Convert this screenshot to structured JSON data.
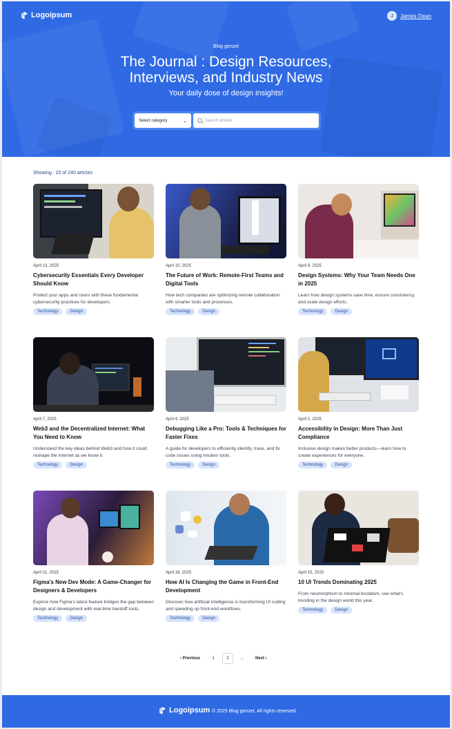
{
  "brand": {
    "name": "Logoipsum",
    "color": "#2f6ae4",
    "logo_icon": "logo-mark-icon"
  },
  "user": {
    "initial": "J",
    "name": "James Dean"
  },
  "hero": {
    "eyebrow": "Blog genzet",
    "title_line1": "The Journal : Design Resources,",
    "title_line2": "Interviews, and Industry News",
    "subtitle": "Your daily dose of design insights!"
  },
  "filters": {
    "category_selected": "Select category",
    "search_placeholder": "Search articles"
  },
  "showing": "Showing : 20 of 240 articles",
  "articles": [
    {
      "date": "April 13, 2025",
      "title": "Cybersecurity Essentials Every Developer Should Know",
      "description": "Protect your apps and users with these fundamental cybersecurity practices for developers.",
      "tags": [
        "Technology",
        "Design"
      ]
    },
    {
      "date": "April 10, 2025",
      "title": "The Future of Work: Remote-First Teams and Digital Tools",
      "description": "How tech companies are optimizing remote collaboration with smarter tools and processes.",
      "tags": [
        "Technology",
        "Design"
      ]
    },
    {
      "date": "April 9, 2025",
      "title": "Design Systems: Why Your Team Needs One in 2025",
      "description": "Learn how design systems save time, ensure consistency, and scale design efforts.",
      "tags": [
        "Technology",
        "Design"
      ]
    },
    {
      "date": "April 7, 2025",
      "title": "Web3 and the Decentralized Internet: What You Need to Know",
      "description": "Understand the key ideas behind Web3 and how it could reshape the internet as we know it.",
      "tags": [
        "Technology",
        "Design"
      ]
    },
    {
      "date": "April 4, 2025",
      "title": "Debugging Like a Pro: Tools & Techniques for Faster Fixes",
      "description": "A guide for developers to efficiently identify, trace, and fix code issues using modern tools.",
      "tags": [
        "Technology",
        "Design"
      ]
    },
    {
      "date": "April 2, 2025",
      "title": "Accessibility in Design: More Than Just Compliance",
      "description": "Inclusive design makes better products—learn how to create experiences for everyone.",
      "tags": [
        "Technology",
        "Design"
      ]
    },
    {
      "date": "April 21, 2025",
      "title": "Figma's New Dev Mode: A Game-Changer for Designers & Developers",
      "description": "Explore how Figma's latest feature bridges the gap between design and development with real-time handoff tools.",
      "tags": [
        "Technology",
        "Design"
      ]
    },
    {
      "date": "April 18, 2025",
      "title": "How AI Is Changing the Game in Front-End Development",
      "description": "Discover how artificial intelligence is transforming UI coding and speeding up front-end workflows.",
      "tags": [
        "Technology",
        "Design"
      ]
    },
    {
      "date": "April 15, 2025",
      "title": "10 UI Trends Dominating 2025",
      "description": "From neumorphism to minimal brutalism, see what's trending in the design world this year.",
      "tags": [
        "Technology",
        "Design"
      ]
    }
  ],
  "pagination": {
    "previous": "Previous",
    "pages": [
      "1",
      "2"
    ],
    "active": "2",
    "ellipsis": "...",
    "next": "Next"
  },
  "footer": {
    "copyright": "© 2025 Blog genzet. All rights reserved."
  }
}
